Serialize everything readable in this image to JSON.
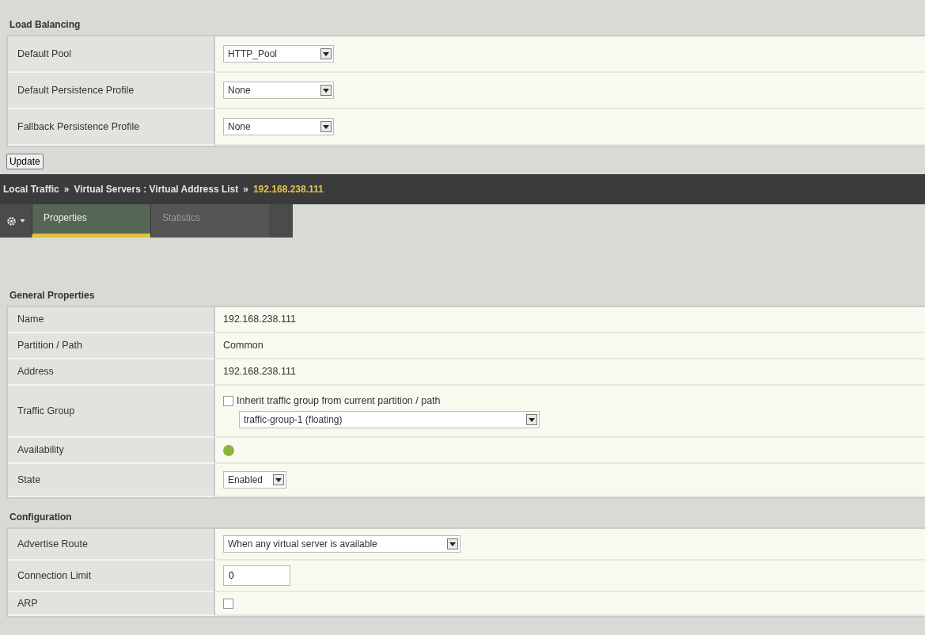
{
  "load_balancing": {
    "title": "Load Balancing",
    "rows": [
      {
        "label": "Default Pool",
        "kind": "select",
        "value": "HTTP_Pool"
      },
      {
        "label": "Default Persistence Profile",
        "kind": "select",
        "value": "None"
      },
      {
        "label": "Fallback Persistence Profile",
        "kind": "select",
        "value": "None"
      }
    ]
  },
  "update_button": "Update",
  "breadcrumb": {
    "separator": "»",
    "crumbs": [
      {
        "text": "Local Traffic",
        "current": false
      },
      {
        "text": "Virtual Servers : Virtual Address List",
        "current": false
      },
      {
        "text": "192.168.238.111",
        "current": true
      }
    ]
  },
  "tabs": [
    {
      "label": "Properties",
      "selected": true
    },
    {
      "label": "Statistics",
      "selected": false
    }
  ],
  "general_properties": {
    "title": "General Properties",
    "rows": [
      {
        "label": "Name",
        "kind": "text",
        "value": "192.168.238.111"
      },
      {
        "label": "Partition / Path",
        "kind": "text",
        "value": "Common"
      },
      {
        "label": "Address",
        "kind": "text",
        "value": "192.168.238.111"
      },
      {
        "label": "Traffic Group",
        "kind": "checkbox_select",
        "checkbox_label": "Inherit traffic group from current partition / path",
        "checked": false,
        "value": "traffic-group-1 (floating)"
      },
      {
        "label": "Availability",
        "kind": "status",
        "color": "#8db33a"
      },
      {
        "label": "State",
        "kind": "select",
        "value": "Enabled"
      }
    ]
  },
  "configuration": {
    "title": "Configuration",
    "rows": [
      {
        "label": "Advertise Route",
        "kind": "select",
        "value": "When any virtual server is available"
      },
      {
        "label": "Connection Limit",
        "kind": "input",
        "value": "0"
      },
      {
        "label": "ARP",
        "kind": "checkbox",
        "checked": false
      }
    ]
  }
}
